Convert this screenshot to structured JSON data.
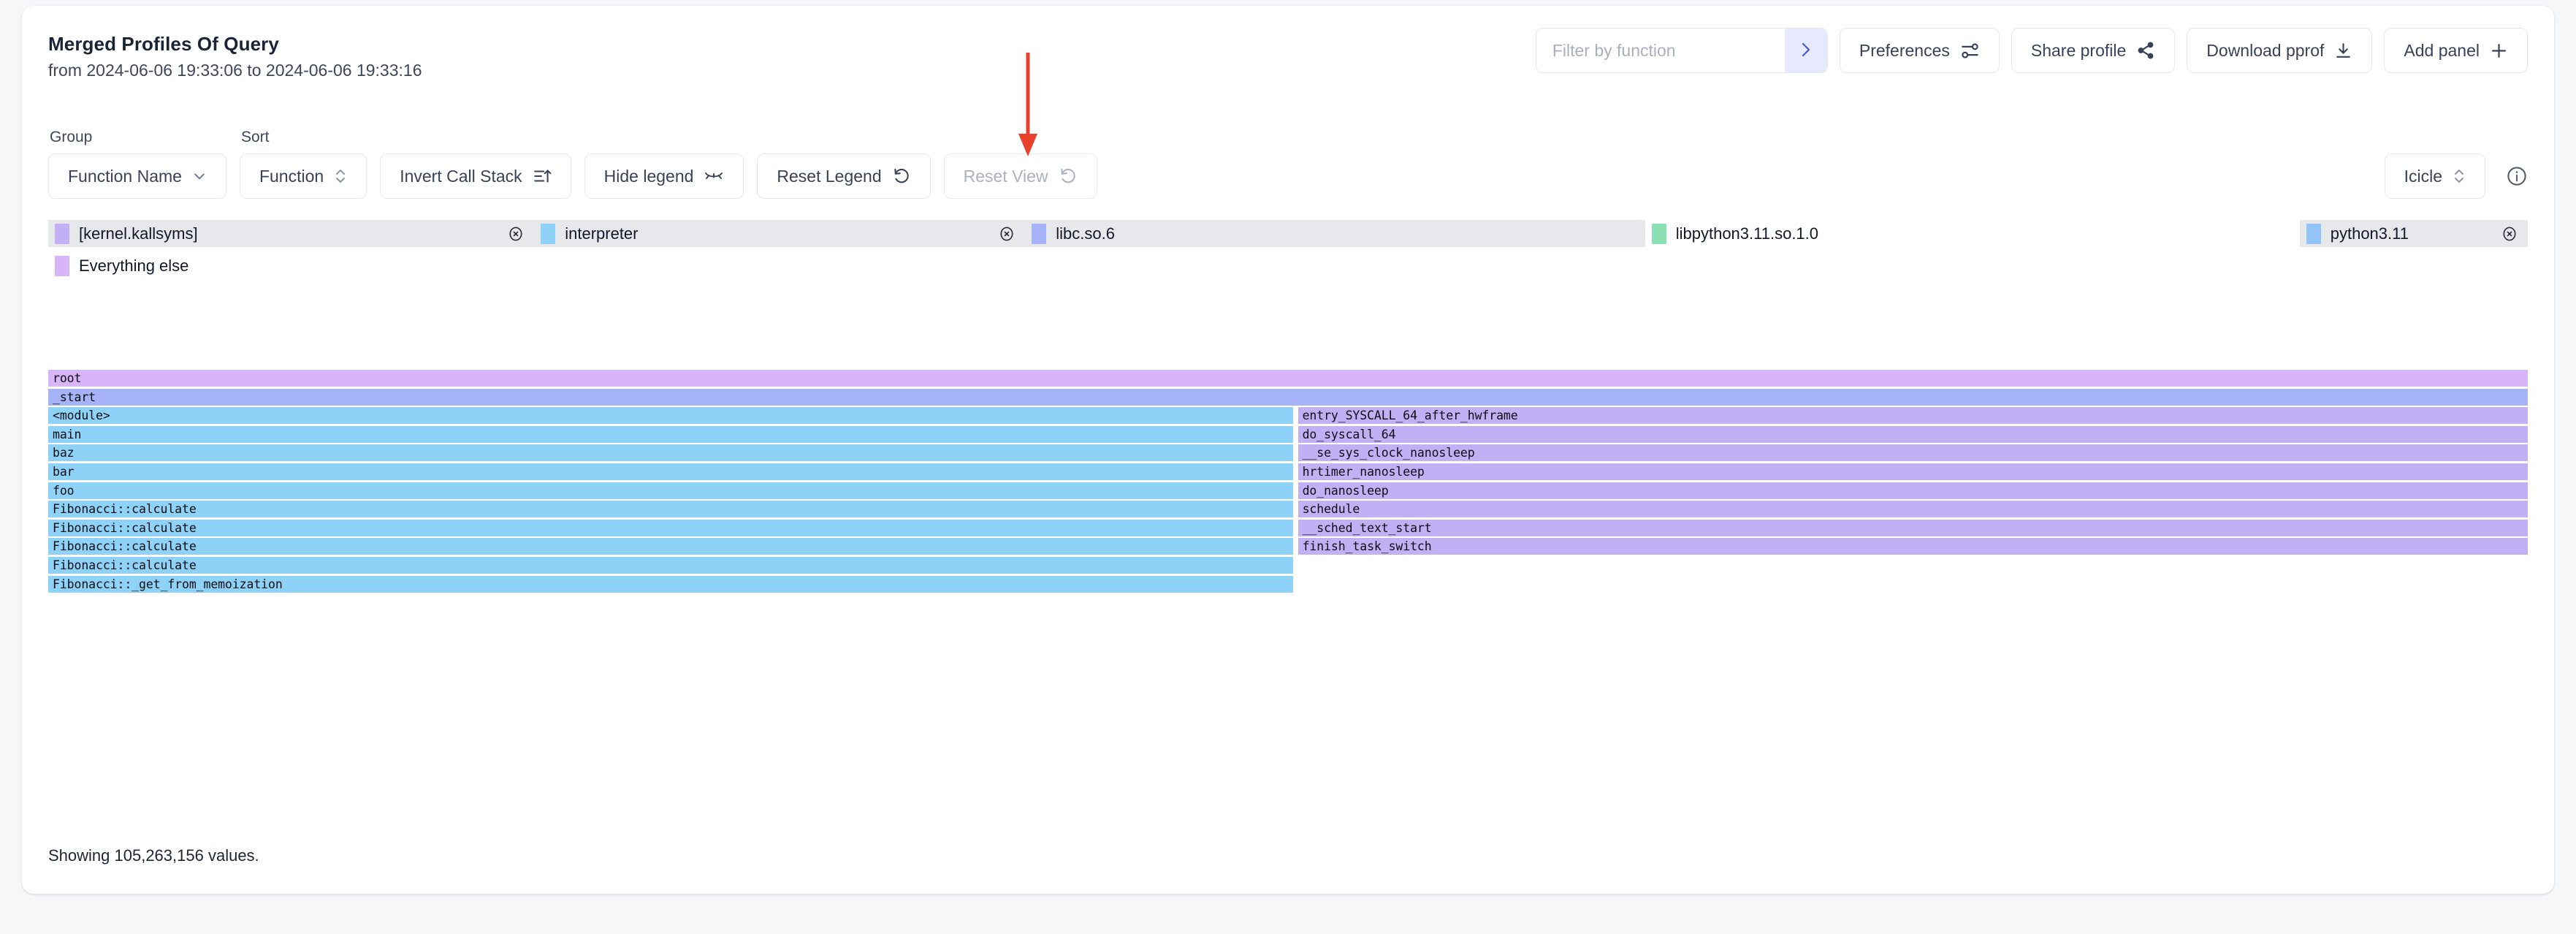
{
  "header": {
    "title": "Merged Profiles Of Query",
    "subtitle": "from 2024-06-06 19:33:06 to 2024-06-06 19:33:16"
  },
  "toolbar": {
    "filter_placeholder": "Filter by function",
    "filter_value": "",
    "filter_submit_icon": "chevron-right-icon",
    "preferences_label": "Preferences",
    "share_label": "Share profile",
    "download_label": "Download pprof",
    "add_panel_label": "Add panel"
  },
  "controls": {
    "group_label": "Group",
    "group_value": "Function Name",
    "sort_label": "Sort",
    "sort_value": "Function",
    "invert_label": "Invert Call Stack",
    "hide_legend_label": "Hide legend",
    "reset_legend_label": "Reset Legend",
    "reset_view_label": "Reset View",
    "reset_view_disabled": true,
    "view_mode": "Icicle",
    "info_icon": "info-circle-icon"
  },
  "legend": {
    "items": [
      {
        "label": "[kernel.kallsyms]",
        "color": "#c2b0f5",
        "selected": true,
        "closable": true
      },
      {
        "label": "interpreter",
        "color": "#8ed2f8",
        "selected": true,
        "closable": true
      },
      {
        "label": "libc.so.6",
        "color": "#a6b4f7",
        "selected": true,
        "closable": false
      },
      {
        "label": "libpython3.11.so.1.0",
        "color": "#8ce0b4",
        "selected": false,
        "closable": false
      },
      {
        "label": "python3.11",
        "color": "#93c3f8",
        "selected": true,
        "closable": true
      },
      {
        "label": "Everything else",
        "color": "#d8b4f8",
        "selected": false,
        "closable": false
      }
    ]
  },
  "chart_data": {
    "type": "icicle",
    "title": "Merged Profiles Of Query",
    "total_values": 105263156,
    "status_text": "Showing 105,263,156 values.",
    "colors": {
      "everything_else": "#d8b4f8",
      "libc": "#a6b4f7",
      "interpreter": "#8ed2f8",
      "kernel": "#c2b0f5",
      "python": "#93c3f8",
      "libpython": "#8ce0b4"
    },
    "rows": [
      {
        "depth": 0,
        "bars": [
          {
            "label": "root",
            "start_pct": 0,
            "width_pct": 100,
            "color": "#d8b4f8"
          }
        ]
      },
      {
        "depth": 1,
        "bars": [
          {
            "label": "_start",
            "start_pct": 0,
            "width_pct": 100,
            "color": "#a6b4f7"
          }
        ]
      },
      {
        "depth": 2,
        "bars": [
          {
            "label": "<module>",
            "start_pct": 0,
            "width_pct": 50.2,
            "color": "#8ed2f8"
          },
          {
            "label": "entry_SYSCALL_64_after_hwframe",
            "start_pct": 50.4,
            "width_pct": 49.6,
            "color": "#c2b0f5"
          }
        ]
      },
      {
        "depth": 3,
        "bars": [
          {
            "label": "main",
            "start_pct": 0,
            "width_pct": 50.2,
            "color": "#8ed2f8"
          },
          {
            "label": "do_syscall_64",
            "start_pct": 50.4,
            "width_pct": 49.6,
            "color": "#c2b0f5"
          }
        ]
      },
      {
        "depth": 4,
        "bars": [
          {
            "label": "baz",
            "start_pct": 0,
            "width_pct": 50.2,
            "color": "#8ed2f8"
          },
          {
            "label": "__se_sys_clock_nanosleep",
            "start_pct": 50.4,
            "width_pct": 49.6,
            "color": "#c2b0f5"
          }
        ]
      },
      {
        "depth": 5,
        "bars": [
          {
            "label": "bar",
            "start_pct": 0,
            "width_pct": 50.2,
            "color": "#8ed2f8"
          },
          {
            "label": "hrtimer_nanosleep",
            "start_pct": 50.4,
            "width_pct": 49.6,
            "color": "#c2b0f5"
          }
        ]
      },
      {
        "depth": 6,
        "bars": [
          {
            "label": "foo",
            "start_pct": 0,
            "width_pct": 50.2,
            "color": "#8ed2f8"
          },
          {
            "label": "do_nanosleep",
            "start_pct": 50.4,
            "width_pct": 49.6,
            "color": "#c2b0f5"
          }
        ]
      },
      {
        "depth": 7,
        "bars": [
          {
            "label": "Fibonacci::calculate",
            "start_pct": 0,
            "width_pct": 50.2,
            "color": "#8ed2f8"
          },
          {
            "label": "schedule",
            "start_pct": 50.4,
            "width_pct": 49.6,
            "color": "#c2b0f5"
          }
        ]
      },
      {
        "depth": 8,
        "bars": [
          {
            "label": "Fibonacci::calculate",
            "start_pct": 0,
            "width_pct": 50.2,
            "color": "#8ed2f8"
          },
          {
            "label": "__sched_text_start",
            "start_pct": 50.4,
            "width_pct": 49.6,
            "color": "#c2b0f5"
          }
        ]
      },
      {
        "depth": 9,
        "bars": [
          {
            "label": "Fibonacci::calculate",
            "start_pct": 0,
            "width_pct": 50.2,
            "color": "#8ed2f8"
          },
          {
            "label": "finish_task_switch",
            "start_pct": 50.4,
            "width_pct": 49.6,
            "color": "#c2b0f5"
          }
        ]
      },
      {
        "depth": 10,
        "bars": [
          {
            "label": "Fibonacci::calculate",
            "start_pct": 0,
            "width_pct": 50.2,
            "color": "#8ed2f8"
          }
        ]
      },
      {
        "depth": 11,
        "bars": [
          {
            "label": "Fibonacci::_get_from_memoization",
            "start_pct": 0,
            "width_pct": 50.2,
            "color": "#8ed2f8"
          }
        ]
      }
    ]
  },
  "status": {
    "text": "Showing 105,263,156 values."
  },
  "annotation": {
    "arrow_color": "#e8402a",
    "points_to": "Reset Legend"
  }
}
